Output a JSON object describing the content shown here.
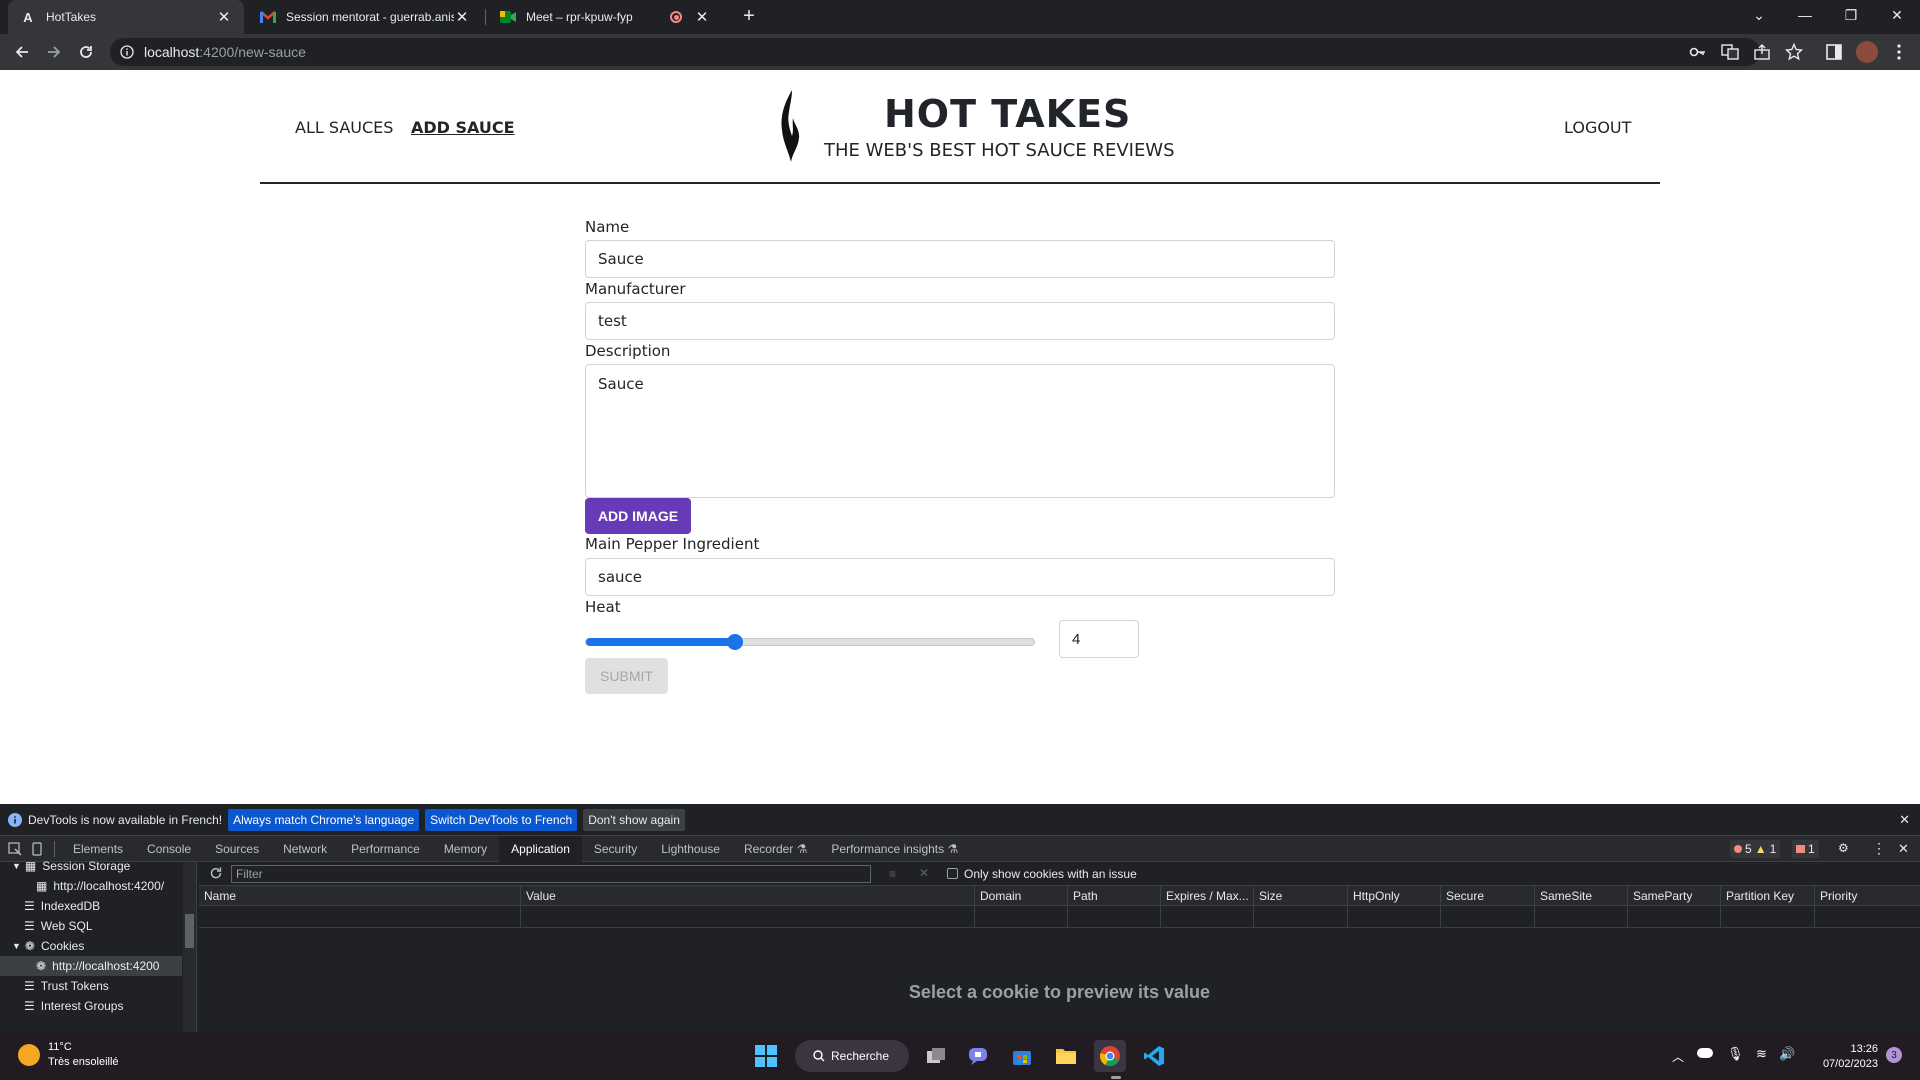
{
  "browser": {
    "tabs": [
      {
        "title": "HotTakes",
        "favicon": "A",
        "active": true
      },
      {
        "title": "Session mentorat - guerrab.aniss",
        "favicon": "M",
        "active": false
      },
      {
        "title": "Meet – rpr-kpuw-fyp",
        "favicon": "meet",
        "active": false
      }
    ],
    "url_host": "localhost",
    "url_path": ":4200/new-sauce"
  },
  "site": {
    "nav": {
      "all_sauces": "ALL SAUCES",
      "add_sauce": "ADD SAUCE",
      "logout": "LOGOUT"
    },
    "brand": {
      "title": "HOT TAKES",
      "subtitle": "THE WEB'S BEST HOT SAUCE REVIEWS"
    }
  },
  "form": {
    "name_label": "Name",
    "name_value": "Sauce",
    "manufacturer_label": "Manufacturer",
    "manufacturer_value": "test",
    "description_label": "Description",
    "description_value": "Sauce",
    "add_image_label": "ADD IMAGE",
    "pepper_label": "Main Pepper Ingredient",
    "pepper_value": "sauce",
    "heat_label": "Heat",
    "heat_value": "4",
    "heat_min": 1,
    "heat_max": 10,
    "submit_label": "SUBMIT",
    "accent_color": "#673ab7"
  },
  "devtools": {
    "infobar": {
      "message": "DevTools is now available in French!",
      "btn_match": "Always match Chrome's language",
      "btn_switch": "Switch DevTools to French",
      "btn_dismiss": "Don't show again"
    },
    "tabs": [
      "Elements",
      "Console",
      "Sources",
      "Network",
      "Performance",
      "Memory",
      "Application",
      "Security",
      "Lighthouse",
      "Recorder",
      "Performance insights"
    ],
    "active_tab": "Application",
    "issues": {
      "errors": "5",
      "warnings": "1",
      "issues": "1"
    },
    "sidebar": [
      {
        "label": "Session Storage",
        "level": 0
      },
      {
        "label": "http://localhost:4200/",
        "level": 1
      },
      {
        "label": "IndexedDB",
        "level": 0
      },
      {
        "label": "Web SQL",
        "level": 0
      },
      {
        "label": "Cookies",
        "level": 0
      },
      {
        "label": "http://localhost:4200",
        "level": 1
      },
      {
        "label": "Trust Tokens",
        "level": 0
      },
      {
        "label": "Interest Groups",
        "level": 0
      }
    ],
    "filter_placeholder": "Filter",
    "only_issues_label": "Only show cookies with an issue",
    "columns": [
      "Name",
      "Value",
      "Domain",
      "Path",
      "Expires / Max...",
      "Size",
      "HttpOnly",
      "Secure",
      "SameSite",
      "SameParty",
      "Partition Key",
      "Priority"
    ],
    "preview_text": "Select a cookie to preview its value"
  },
  "taskbar": {
    "weather_temp": "11°C",
    "weather_desc": "Très ensoleillé",
    "search_label": "Recherche",
    "time": "13:26",
    "date": "07/02/2023",
    "notification_count": "3"
  }
}
